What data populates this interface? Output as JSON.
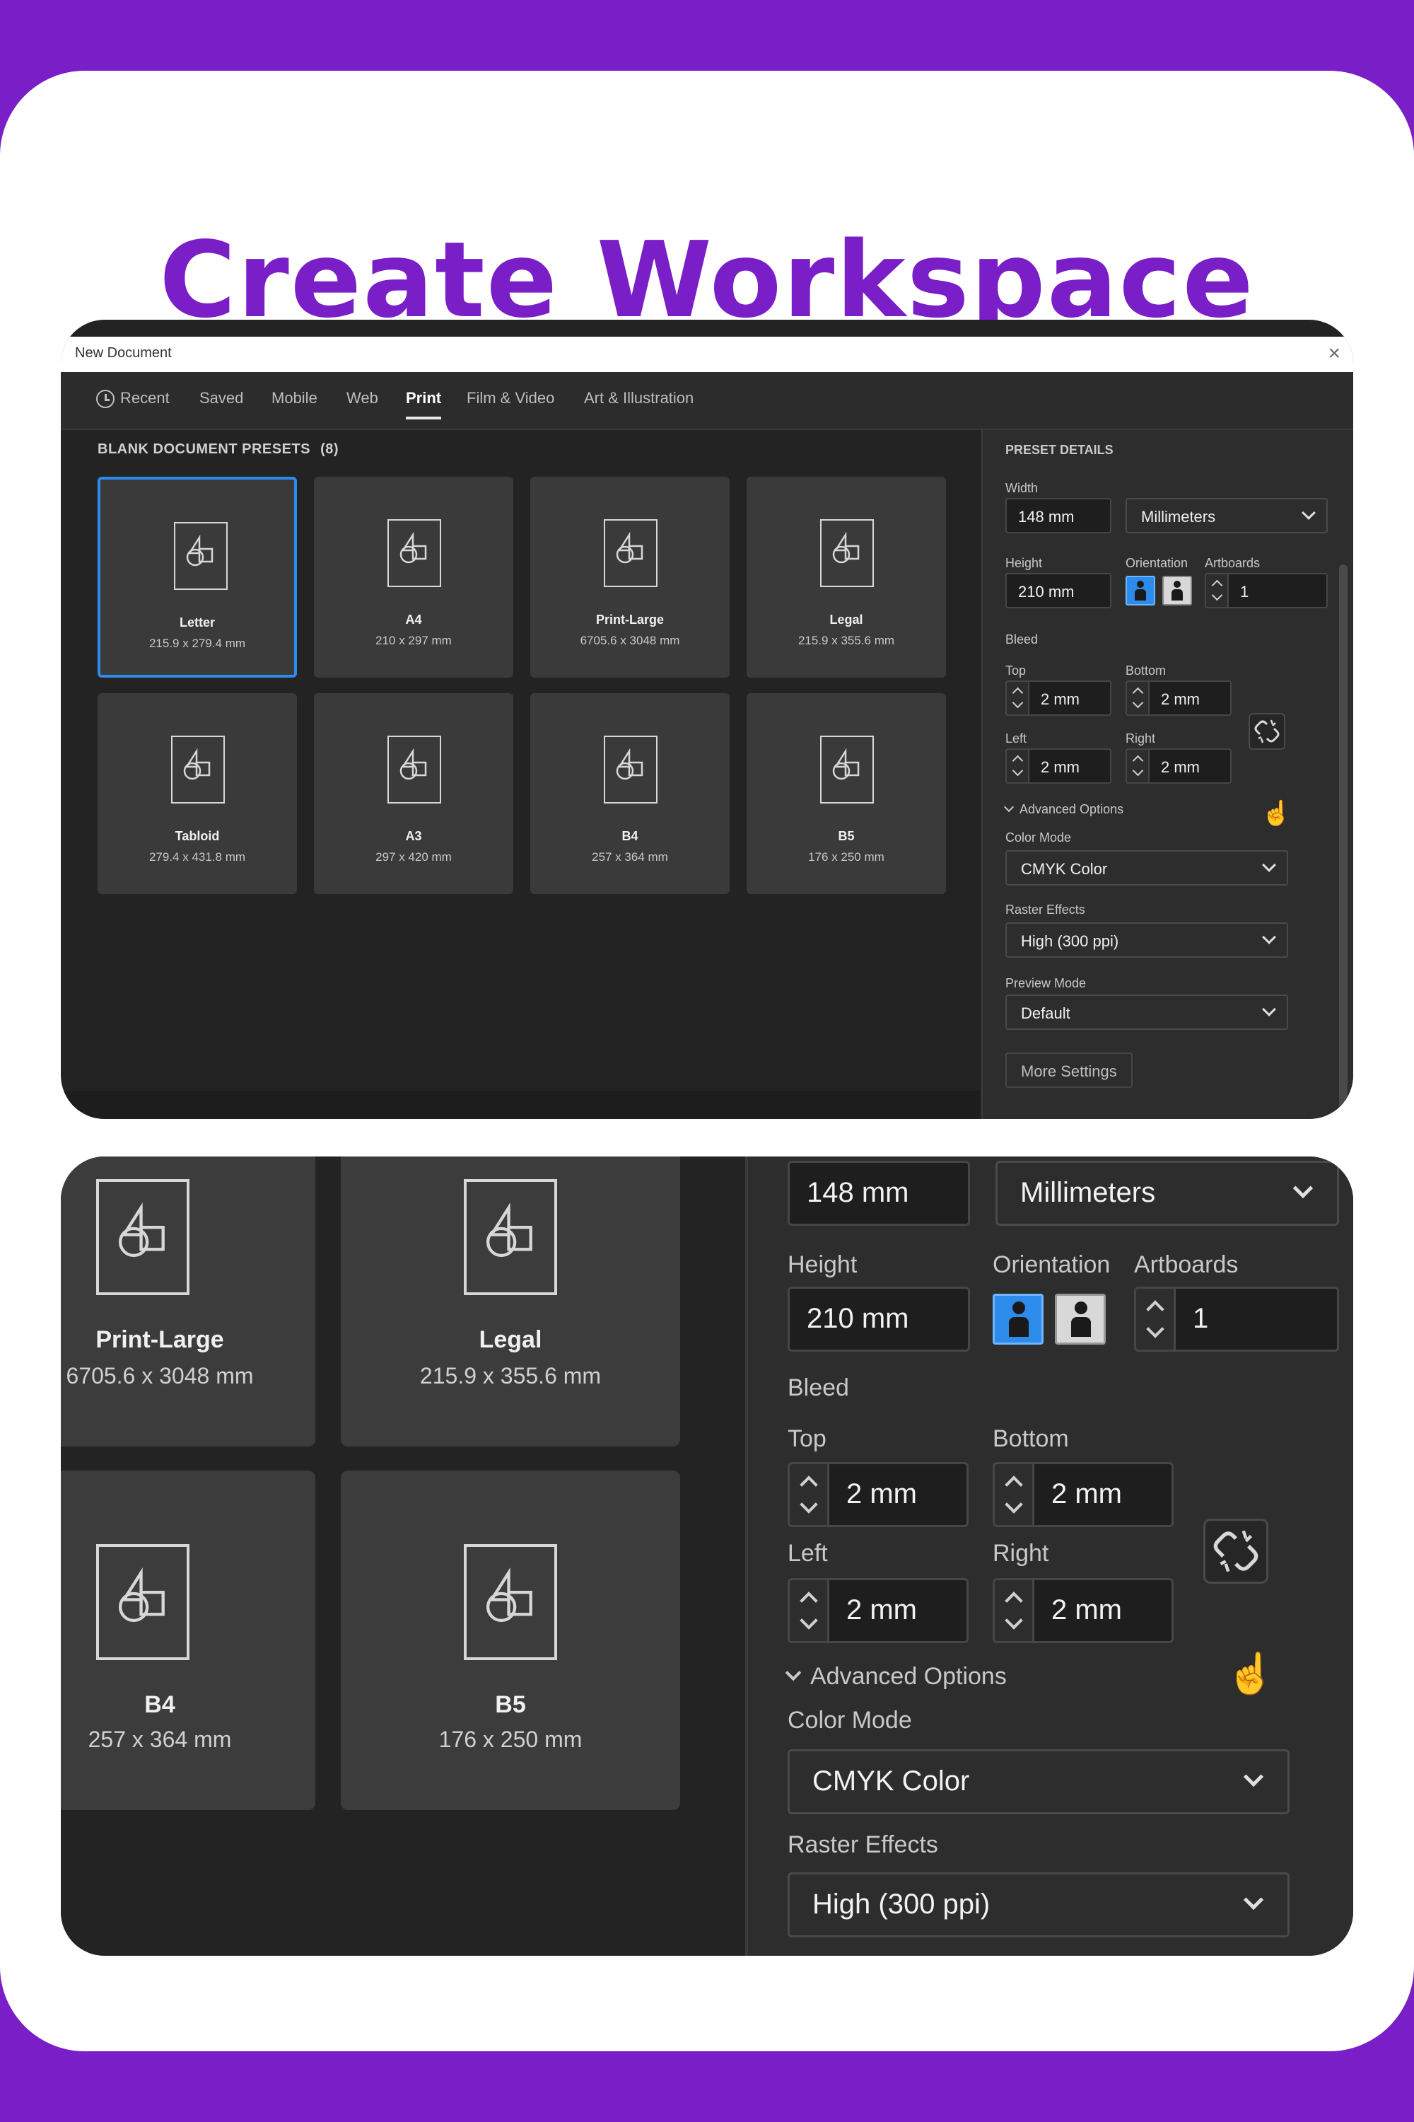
{
  "headline": "Create Workspace",
  "dialog": {
    "title": "New Document",
    "close_glyph": "×",
    "tabs": [
      "Recent",
      "Saved",
      "Mobile",
      "Web",
      "Print",
      "Film & Video",
      "Art & Illustration"
    ],
    "active_tab": "Print",
    "presets_label": "BLANK DOCUMENT PRESETS",
    "presets_count": "(8)",
    "presets": [
      {
        "name": "Letter",
        "size": "215.9 x 279.4 mm",
        "selected": true
      },
      {
        "name": "A4",
        "size": "210 x 297 mm"
      },
      {
        "name": "Print-Large",
        "size": "6705.6 x 3048 mm"
      },
      {
        "name": "Legal",
        "size": "215.9 x 355.6 mm"
      },
      {
        "name": "Tabloid",
        "size": "279.4 x 431.8 mm"
      },
      {
        "name": "A3",
        "size": "297 x 420 mm"
      },
      {
        "name": "B4",
        "size": "257 x 364 mm"
      },
      {
        "name": "B5",
        "size": "176 x 250 mm"
      }
    ],
    "details": {
      "header": "PRESET DETAILS",
      "width_label": "Width",
      "width_value": "148 mm",
      "units": "Millimeters",
      "height_label": "Height",
      "height_value": "210 mm",
      "orientation_label": "Orientation",
      "artboards_label": "Artboards",
      "artboards_value": "1",
      "bleed_label": "Bleed",
      "top_label": "Top",
      "top_value": "2 mm",
      "bottom_label": "Bottom",
      "bottom_value": "2 mm",
      "left_label": "Left",
      "left_value": "2 mm",
      "right_label": "Right",
      "right_value": "2 mm",
      "advanced_label": "Advanced Options",
      "color_mode_label": "Color Mode",
      "color_mode_value": "CMYK Color",
      "raster_label": "Raster Effects",
      "raster_value": "High (300 ppi)",
      "preview_label": "Preview Mode",
      "preview_value": "Default",
      "more_settings": "More Settings"
    }
  },
  "zoom": {
    "presets": [
      {
        "name": "Print-Large",
        "size": "6705.6 x 3048 mm"
      },
      {
        "name": "Legal",
        "size": "215.9 x 355.6 mm"
      },
      {
        "name": "B4",
        "size": "257 x 364 mm"
      },
      {
        "name": "B5",
        "size": "176 x 250 mm"
      }
    ]
  },
  "colors": {
    "brand_purple": "#7a1ec8",
    "accent_blue": "#2d8ceb",
    "panel_dark": "#232323"
  }
}
